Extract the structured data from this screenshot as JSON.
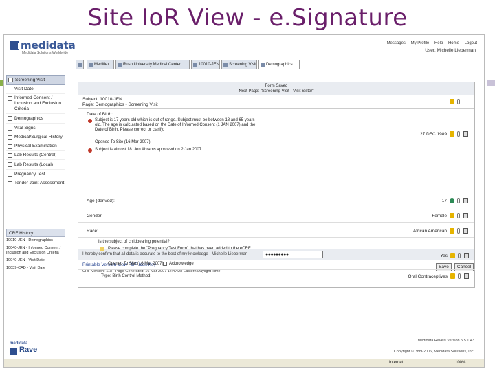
{
  "slide": {
    "title": "Site IoR View - e.Signature"
  },
  "app": {
    "brand": "medidata",
    "brand_sub": "Medidata Solutions Worldwide",
    "toplinks": [
      "Messages",
      "My Profile",
      "Help",
      "Home",
      "Logout"
    ],
    "user_line": "User: Michelle Lieberman"
  },
  "tabs": [
    {
      "label": ""
    },
    {
      "label": "Mediflex"
    },
    {
      "label": "Rush University Medical Center"
    },
    {
      "label": "10010-JEN"
    },
    {
      "label": "Screening Visit"
    },
    {
      "label": "Demographics"
    }
  ],
  "sidebar": {
    "folders": [
      "Screening Visit",
      "Visit Date",
      "Informed Consent / Inclusion and Exclusion Criteria",
      "Demographics",
      "Vital Signs",
      "Medical/Surgical History",
      "Physical Examination",
      "Lab Results (Central)",
      "Lab Results (Local)",
      "Pregnancy Test",
      "Tender Joint Assessment"
    ],
    "crf_history_label": "CRF History",
    "crf_history": [
      "10010-JEN - Demographics",
      "10040-JEN - Informed Consent / Inclusion and Exclusion Criteria",
      "10040-JEN - Visit Date",
      "10039-CAD - Visit Date"
    ],
    "logo_small": "medidata",
    "logo_big": "Rave"
  },
  "form": {
    "saved_title": "Form Saved",
    "saved_sub": "Next Page: \"Screening Visit - Visit Sister\"",
    "subject": "Subject: 10010-JEN",
    "page": "Page: Demographics - Screening Visit",
    "dob_label": "Date of Birth:",
    "dob_query": "Subject is 17 years old which is out of range. Subject must be between 18 and 65 years old. The age is calculated based on the Date of Informed Consent (1 JAN 2007) and the Date of Birth. Please correct or clarify.",
    "dob_opened": "Opened To Site (16 Mar 2007)",
    "dob_value": "27 DEC 1989",
    "dob_reply": "Subject is almost 18. Jen Abrams approved on 2 Jan 2007",
    "age_label": "Age (derived):",
    "age_value": "17",
    "gender_label": "Gender:",
    "gender_value": "Female",
    "race_label": "Race:",
    "race_value": "African American",
    "childbearing_label": "Is the subject of childbearing potential?",
    "childbearing_note": "Please complete the \"Pregnancy Test Form\" that has been added to the eCRF.",
    "childbearing_opened": "Opened To Site (16 Mar 2007)",
    "acknowledge_label": "Acknowledge",
    "childbearing_value": "Yes",
    "birth_control_label": "Type: Birth Control Method:",
    "birth_control_value": "Oral Contraceptives",
    "sign_text": "I hereby confirm that all data is accurate to the best of my knowledge - Michelle Lieberman",
    "password_value": "●●●●●●●●●",
    "links": "Printable Version  View PDF  Icon Key",
    "footer_info": "CRF Version: 118 - Page Generated: 16 Mar 2007 14:47:28 Eastern Daylight Time",
    "save_label": "Save",
    "cancel_label": "Cancel"
  },
  "footer": {
    "version": "Medidata Rave® Version 5.5.1.43",
    "copyright": "Copyright ©1999-2006, Medidata Solutions, Inc.",
    "status_zone": "Internet",
    "zoom": "100%"
  }
}
